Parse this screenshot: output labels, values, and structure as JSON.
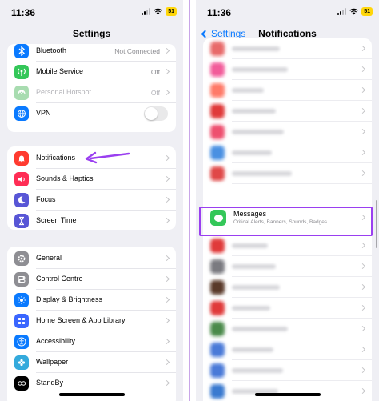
{
  "left": {
    "status": {
      "time": "11:36",
      "battery": "51"
    },
    "title": "Settings",
    "group1": [
      {
        "label": "Bluetooth",
        "value": "Not Connected",
        "icon": "bluetooth-icon",
        "color": "#0a7aff"
      },
      {
        "label": "Mobile Service",
        "value": "Off",
        "icon": "antenna-icon",
        "color": "#34c759"
      },
      {
        "label": "Personal Hotspot",
        "value": "Off",
        "icon": "hotspot-icon",
        "color": "#a8dcb0",
        "disabled": true
      },
      {
        "label": "VPN",
        "icon": "globe-icon",
        "color": "#0a7aff",
        "toggle": false
      }
    ],
    "group2": [
      {
        "label": "Notifications",
        "icon": "bell-icon",
        "color": "#ff3b30"
      },
      {
        "label": "Sounds & Haptics",
        "icon": "speaker-icon",
        "color": "#ff2d55"
      },
      {
        "label": "Focus",
        "icon": "moon-icon",
        "color": "#5856d6"
      },
      {
        "label": "Screen Time",
        "icon": "hourglass-icon",
        "color": "#5856d6"
      }
    ],
    "group3": [
      {
        "label": "General",
        "icon": "gear-icon",
        "color": "#8e8e93"
      },
      {
        "label": "Control Centre",
        "icon": "switches-icon",
        "color": "#8e8e93"
      },
      {
        "label": "Display & Brightness",
        "icon": "sun-icon",
        "color": "#0a7aff"
      },
      {
        "label": "Home Screen & App Library",
        "icon": "grid-icon",
        "color": "#3a66ff"
      },
      {
        "label": "Accessibility",
        "icon": "accessibility-icon",
        "color": "#0a7aff"
      },
      {
        "label": "Wallpaper",
        "icon": "flower-icon",
        "color": "#34aadc"
      },
      {
        "label": "StandBy",
        "icon": "standby-icon",
        "color": "#000000"
      }
    ]
  },
  "right": {
    "status": {
      "time": "11:36",
      "battery": "51"
    },
    "back": "Settings",
    "title": "Notifications",
    "messages": {
      "label": "Messages",
      "subtitle": "Critical Alerts, Banners, Sounds, Badges"
    }
  },
  "colors": {
    "accent": "#0a7aff",
    "highlight": "#9a3ff0",
    "messages_green": "#34c759"
  }
}
